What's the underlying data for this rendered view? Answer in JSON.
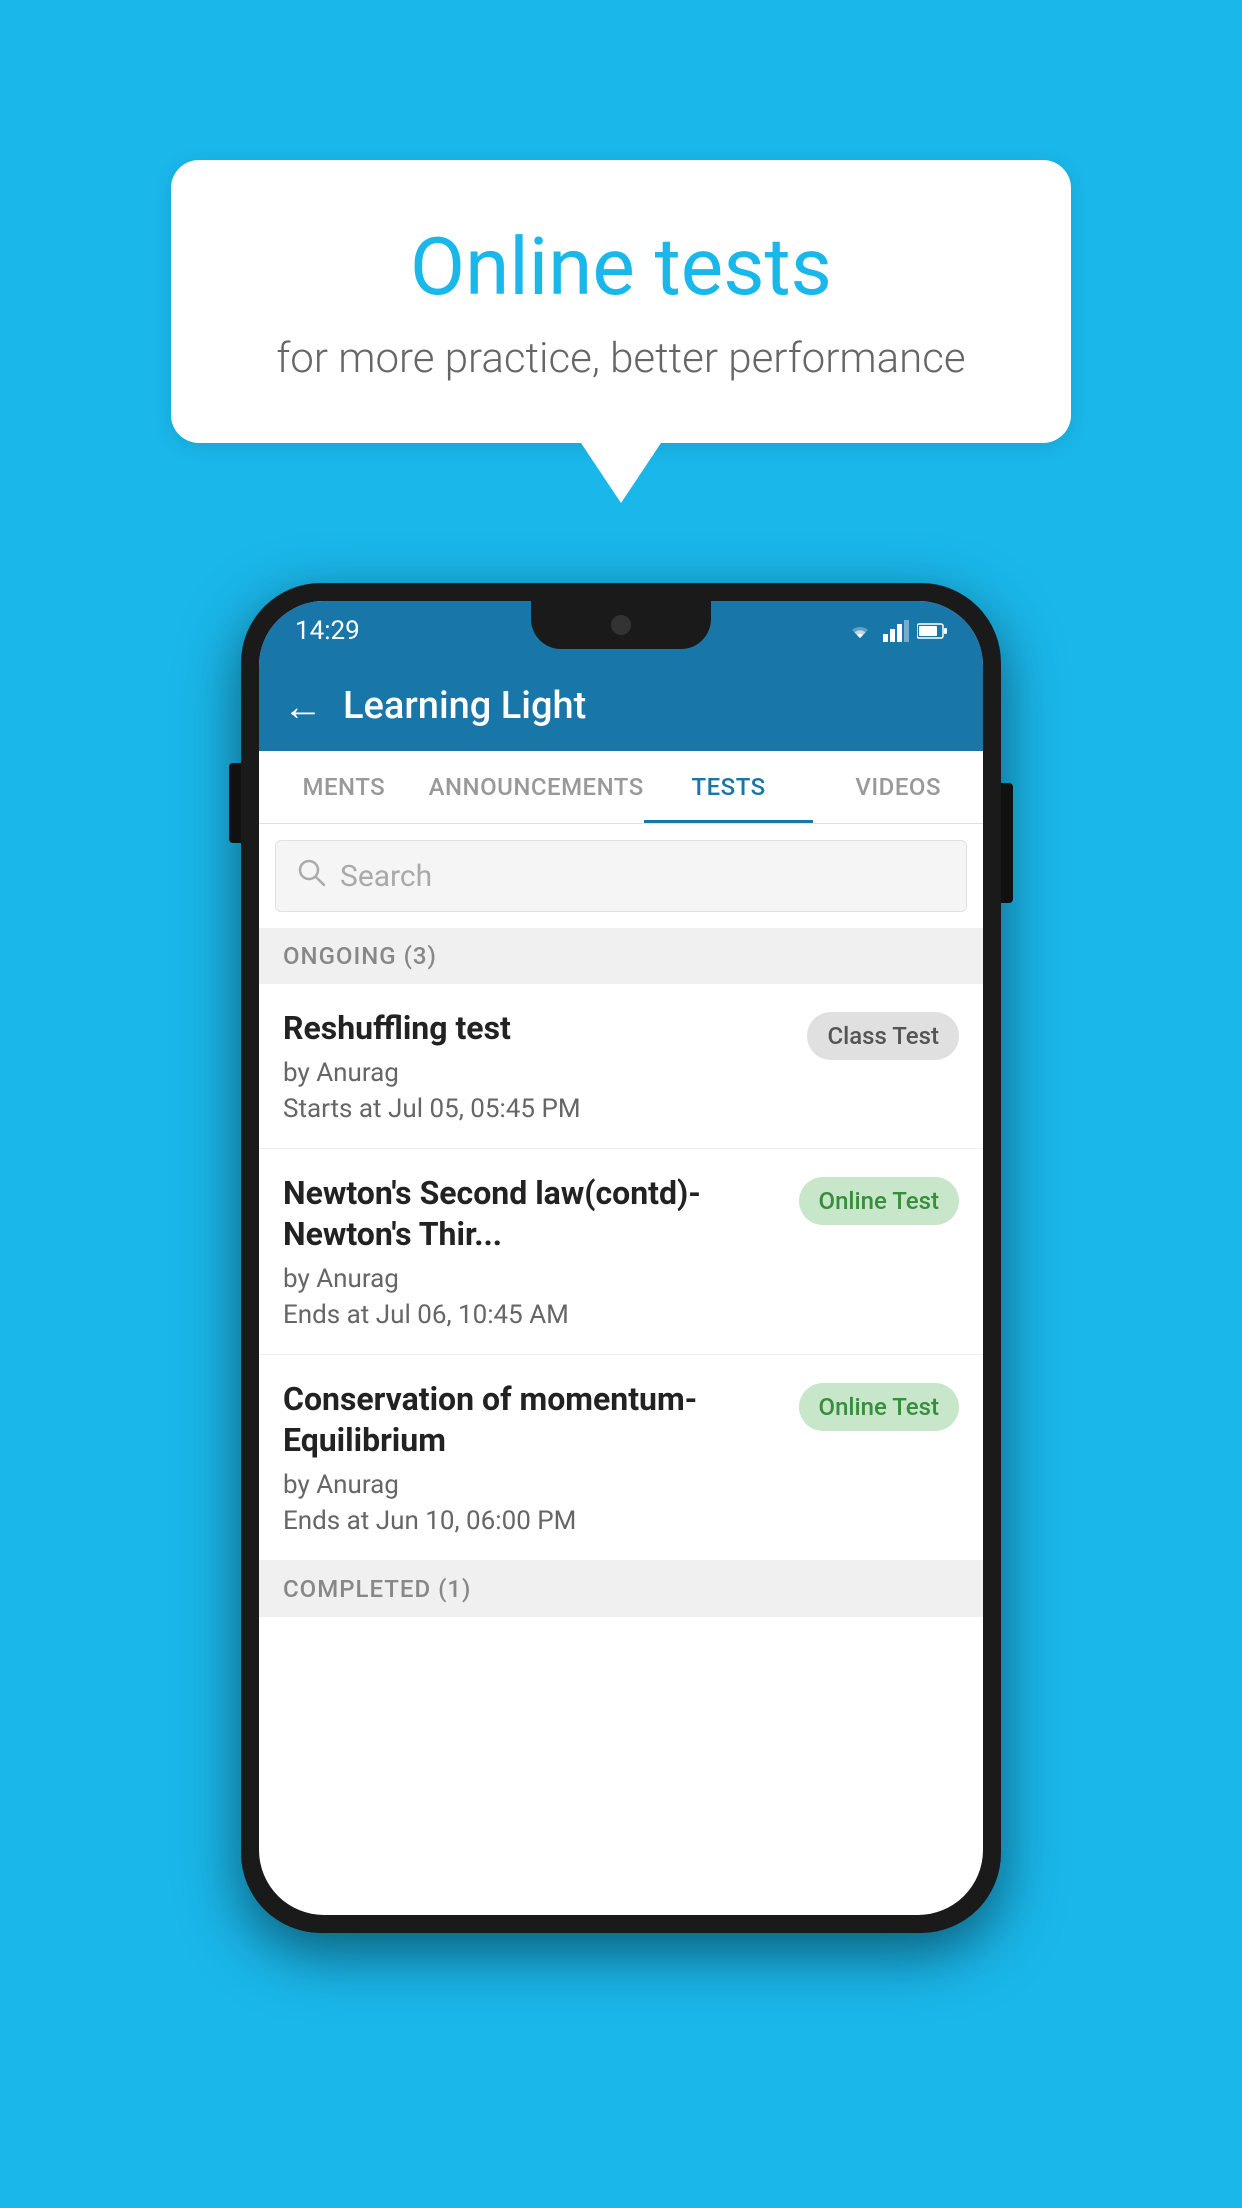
{
  "background_color": "#1ab7ea",
  "speech_bubble": {
    "title": "Online tests",
    "subtitle": "for more practice, better performance"
  },
  "phone": {
    "status_bar": {
      "time": "14:29",
      "icons": [
        "wifi",
        "signal",
        "battery"
      ]
    },
    "app_bar": {
      "back_label": "←",
      "title": "Learning Light"
    },
    "tabs": [
      {
        "label": "MENTS",
        "active": false
      },
      {
        "label": "ANNOUNCEMENTS",
        "active": false
      },
      {
        "label": "TESTS",
        "active": true
      },
      {
        "label": "VIDEOS",
        "active": false
      }
    ],
    "search": {
      "placeholder": "Search"
    },
    "ongoing_section": {
      "label": "ONGOING (3)"
    },
    "test_items": [
      {
        "title": "Reshuffling test",
        "by": "by Anurag",
        "time_label": "Starts at",
        "time": "Jul 05, 05:45 PM",
        "badge": "Class Test",
        "badge_type": "class"
      },
      {
        "title": "Newton's Second law(contd)-Newton's Thir...",
        "by": "by Anurag",
        "time_label": "Ends at",
        "time": "Jul 06, 10:45 AM",
        "badge": "Online Test",
        "badge_type": "online"
      },
      {
        "title": "Conservation of momentum-Equilibrium",
        "by": "by Anurag",
        "time_label": "Ends at",
        "time": "Jun 10, 06:00 PM",
        "badge": "Online Test",
        "badge_type": "online"
      }
    ],
    "completed_section": {
      "label": "COMPLETED (1)"
    }
  }
}
